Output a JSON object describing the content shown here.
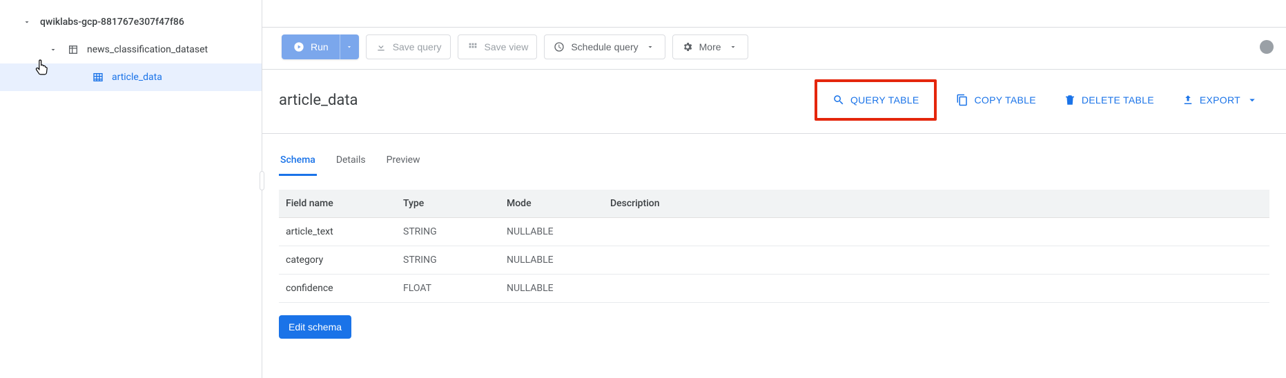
{
  "sidebar": {
    "project": "qwiklabs-gcp-881767e307f47f86",
    "dataset": "news_classification_dataset",
    "table": "article_data"
  },
  "toolbar": {
    "run": "Run",
    "save_query": "Save query",
    "save_view": "Save view",
    "schedule_query": "Schedule query",
    "more": "More"
  },
  "header": {
    "title": "article_data",
    "query_table": "QUERY TABLE",
    "copy_table": "COPY TABLE",
    "delete_table": "DELETE TABLE",
    "export": "EXPORT"
  },
  "tabs": {
    "schema": "Schema",
    "details": "Details",
    "preview": "Preview"
  },
  "schema_table": {
    "headers": {
      "field": "Field name",
      "type": "Type",
      "mode": "Mode",
      "desc": "Description"
    },
    "rows": [
      {
        "field": "article_text",
        "type": "STRING",
        "mode": "NULLABLE",
        "desc": ""
      },
      {
        "field": "category",
        "type": "STRING",
        "mode": "NULLABLE",
        "desc": ""
      },
      {
        "field": "confidence",
        "type": "FLOAT",
        "mode": "NULLABLE",
        "desc": ""
      }
    ],
    "edit": "Edit schema"
  }
}
